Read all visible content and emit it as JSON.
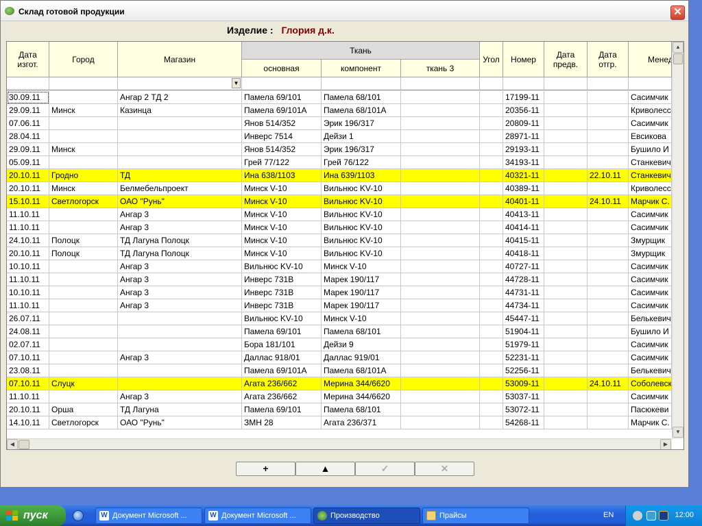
{
  "window": {
    "title": "Склад готовой продукции",
    "close_glyph": "✕"
  },
  "header": {
    "label": "Изделие :",
    "value": "Глория д.к."
  },
  "columns": {
    "date_made": "Дата\nизгот.",
    "city": "Город",
    "shop": "Магазин",
    "fabric_group": "Ткань",
    "fabric_main": "основная",
    "fabric_component": "компонент",
    "fabric_3": "ткань 3",
    "corner": "Угол",
    "number": "Номер",
    "date_prelim": "Дата\nпредв.",
    "date_ship": "Дата\nотгр.",
    "manager": "Менеджер"
  },
  "rows": [
    [
      "30.09.11",
      "",
      "Ангар 2 ТД 2",
      "Памела 69/101",
      "Памела 68/101",
      "",
      "",
      "17199-11",
      "",
      "",
      "Сасимчик"
    ],
    [
      "29.09.11",
      "Минск",
      "Казинца",
      "Памела 69/101А",
      "Памела 68/101А",
      "",
      "",
      "20356-11",
      "",
      "",
      "Криволесс"
    ],
    [
      "07.06.11",
      "",
      "",
      "Янов 514/352",
      "Эрик 196/317",
      "",
      "",
      "20809-11",
      "",
      "",
      "Сасимчик"
    ],
    [
      "28.04.11",
      "",
      "",
      "Инверс 7514",
      "Дейзи 1",
      "",
      "",
      "28971-11",
      "",
      "",
      "Евсикова"
    ],
    [
      "29.09.11",
      "Минск",
      "",
      "Янов 514/352",
      "Эрик 196/317",
      "",
      "",
      "29193-11",
      "",
      "",
      "Бушило И"
    ],
    [
      "05.09.11",
      "",
      "",
      "Грей 77/122",
      "Грей 76/122",
      "",
      "",
      "34193-11",
      "",
      "",
      "Станкевич"
    ],
    [
      "20.10.11",
      "Гродно",
      "ТД",
      "Ина 638/1103",
      "Ина 639/1103",
      "",
      "",
      "40321-11",
      "",
      "22.10.11",
      "Станкевич"
    ],
    [
      "20.10.11",
      "Минск",
      "Белмебельпроект",
      "Минск V-10",
      "Вильнюс KV-10",
      "",
      "",
      "40389-11",
      "",
      "",
      "Криволесс"
    ],
    [
      "15.10.11",
      "Светлогорск",
      "ОАО \"Рунь\"",
      "Минск V-10",
      "Вильнюс KV-10",
      "",
      "",
      "40401-11",
      "",
      "24.10.11",
      "Марчик С."
    ],
    [
      "11.10.11",
      "",
      "Ангар 3",
      "Минск V-10",
      "Вильнюс KV-10",
      "",
      "",
      "40413-11",
      "",
      "",
      "Сасимчик"
    ],
    [
      "11.10.11",
      "",
      "Ангар 3",
      "Минск V-10",
      "Вильнюс KV-10",
      "",
      "",
      "40414-11",
      "",
      "",
      "Сасимчик"
    ],
    [
      "24.10.11",
      "Полоцк",
      "ТД Лагуна Полоцк",
      "Минск V-10",
      "Вильнюс KV-10",
      "",
      "",
      "40415-11",
      "",
      "",
      "Змурщик"
    ],
    [
      "20.10.11",
      "Полоцк",
      "ТД Лагуна Полоцк",
      "Минск V-10",
      "Вильнюс KV-10",
      "",
      "",
      "40418-11",
      "",
      "",
      "Змурщик"
    ],
    [
      "10.10.11",
      "",
      "Ангар 3",
      "Вильнюс KV-10",
      "Минск V-10",
      "",
      "",
      "40727-11",
      "",
      "",
      "Сасимчик"
    ],
    [
      "11.10.11",
      "",
      "Ангар 3",
      "Инверс 731В",
      "Марек 190/117",
      "",
      "",
      "44728-11",
      "",
      "",
      "Сасимчик"
    ],
    [
      "10.10.11",
      "",
      "Ангар 3",
      "Инверс 731В",
      "Марек 190/117",
      "",
      "",
      "44731-11",
      "",
      "",
      "Сасимчик"
    ],
    [
      "11.10.11",
      "",
      "Ангар 3",
      "Инверс 731В",
      "Марек 190/117",
      "",
      "",
      "44734-11",
      "",
      "",
      "Сасимчик"
    ],
    [
      "26.07.11",
      "",
      "",
      "Вильнюс KV-10",
      "Минск V-10",
      "",
      "",
      "45447-11",
      "",
      "",
      "Белькевич"
    ],
    [
      "24.08.11",
      "",
      "",
      "Памела 69/101",
      "Памела 68/101",
      "",
      "",
      "51904-11",
      "",
      "",
      "Бушило И"
    ],
    [
      "02.07.11",
      "",
      "",
      "Бора 181/101",
      "Дейзи 9",
      "",
      "",
      "51979-11",
      "",
      "",
      "Сасимчик"
    ],
    [
      "07.10.11",
      "",
      "Ангар 3",
      "Даллас 918/01",
      "Даллас 919/01",
      "",
      "",
      "52231-11",
      "",
      "",
      "Сасимчик"
    ],
    [
      "23.08.11",
      "",
      "",
      "Памела 69/101А",
      "Памела 68/101А",
      "",
      "",
      "52256-11",
      "",
      "",
      "Белькевич"
    ],
    [
      "07.10.11",
      "Слуцк",
      "",
      "Агата 236/662",
      "Мерина 344/6620",
      "",
      "",
      "53009-11",
      "",
      "24.10.11",
      "Соболевск"
    ],
    [
      "11.10.11",
      "",
      "Ангар 3",
      "Агата 236/662",
      "Мерина 344/6620",
      "",
      "",
      "53037-11",
      "",
      "",
      "Сасимчик"
    ],
    [
      "20.10.11",
      "Орша",
      "ТД Лагуна",
      "Памела 69/101",
      "Памела 68/101",
      "",
      "",
      "53072-11",
      "",
      "",
      "Пасюкеви"
    ],
    [
      "14.10.11",
      "Светлогорск",
      "ОАО \"Рунь\"",
      "ЗМН 28",
      "Агата 236/371",
      "",
      "",
      "54268-11",
      "",
      "",
      "Марчик С."
    ]
  ],
  "highlighted_rows": [
    6,
    8,
    22
  ],
  "highlight_color": "#ffff00",
  "toolbar": {
    "add": "+",
    "up": "▲",
    "confirm": "✓",
    "delete": "✕"
  },
  "taskbar": {
    "start_label": "пуск",
    "tasks": [
      "Документ Microsoft ...",
      "Документ Microsoft ...",
      "Производство",
      "Прайсы"
    ],
    "language": "EN",
    "clock": "12:00"
  }
}
